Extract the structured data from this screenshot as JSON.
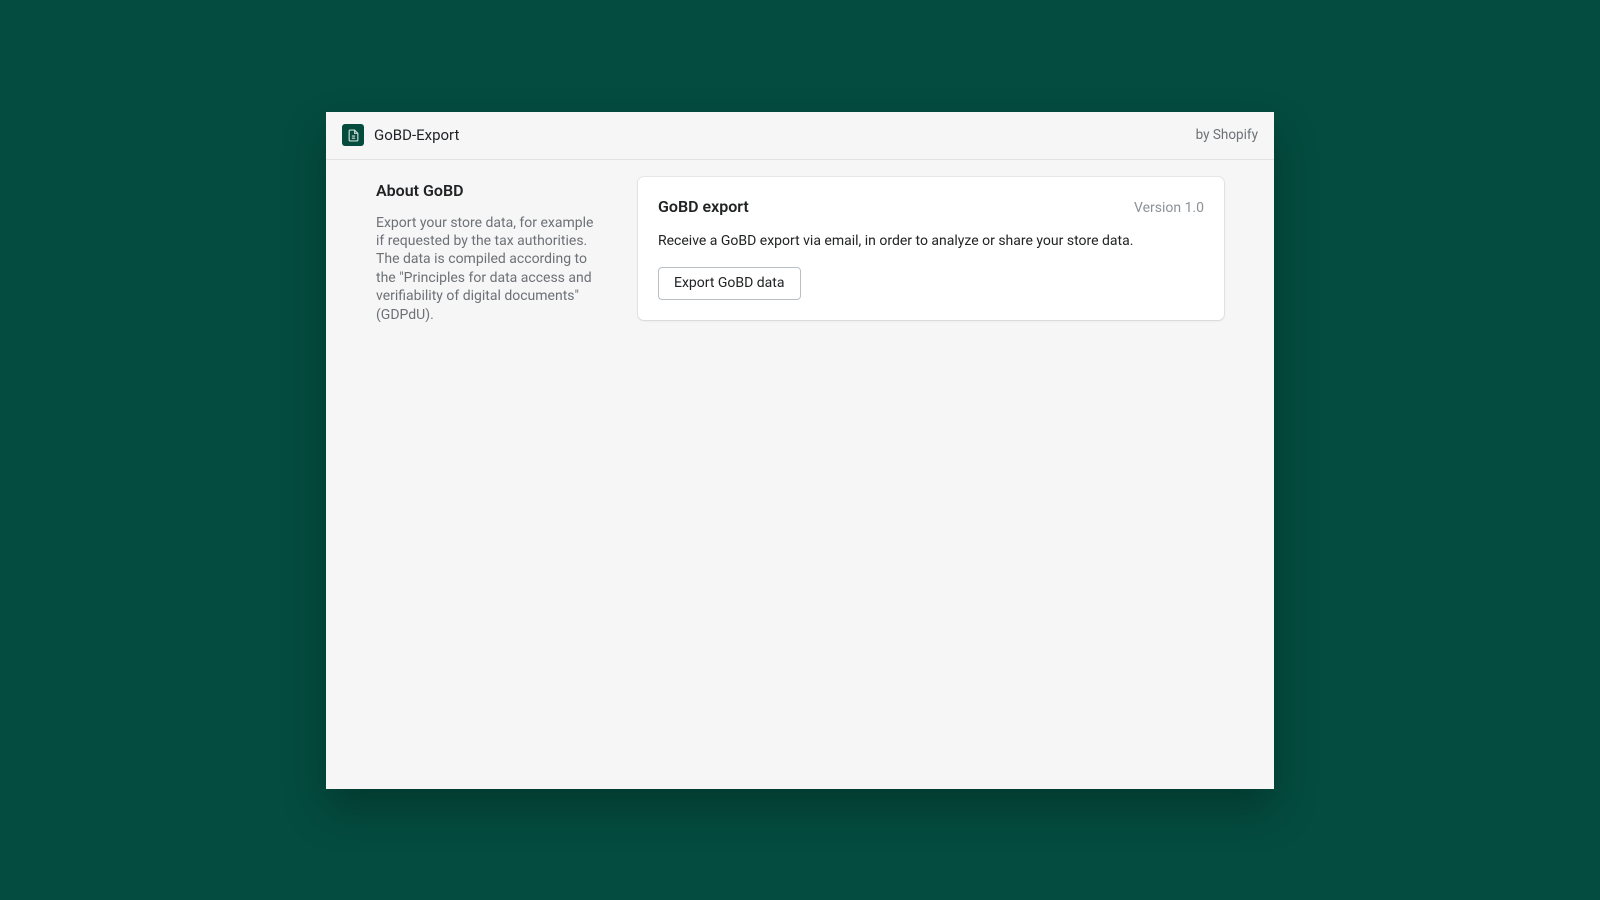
{
  "header": {
    "app_title": "GoBD-Export",
    "byline": "by Shopify",
    "icon_name": "document-icon"
  },
  "about": {
    "title": "About GoBD",
    "description": "Export your store data, for example if requested by the tax authorities. The data is compiled according to the \"Principles for data access and verifiability of digital documents\" (GDPdU)."
  },
  "card": {
    "title": "GoBD export",
    "version": "Version 1.0",
    "description": "Receive a GoBD export via email, in order to analyze or share your store data.",
    "button_label": "Export GoBD data"
  },
  "colors": {
    "background": "#044c3f",
    "panel": "#f6f6f7",
    "card": "#ffffff",
    "text_primary": "#202223",
    "text_secondary": "#6d7175"
  }
}
